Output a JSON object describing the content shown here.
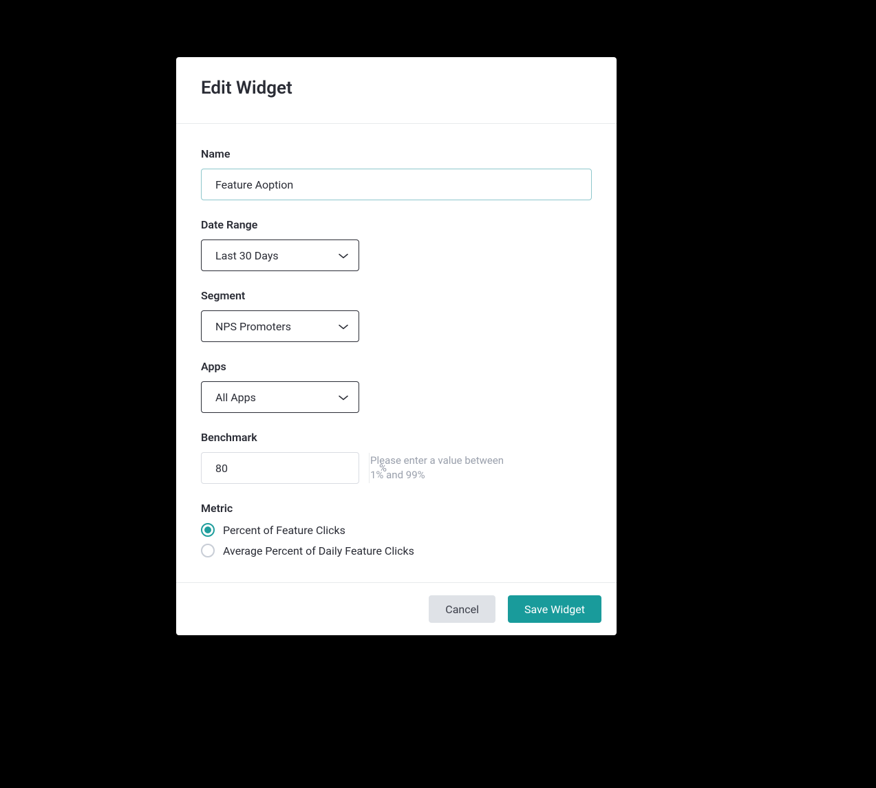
{
  "modal": {
    "title": "Edit Widget",
    "fields": {
      "name": {
        "label": "Name",
        "value": "Feature Aoption"
      },
      "date_range": {
        "label": "Date Range",
        "selected": "Last 30 Days"
      },
      "segment": {
        "label": "Segment",
        "selected": "NPS Promoters"
      },
      "apps": {
        "label": "Apps",
        "selected": "All Apps"
      },
      "benchmark": {
        "label": "Benchmark",
        "value": "80",
        "suffix": "%",
        "hint": "Please enter a value between 1% and 99%"
      },
      "metric": {
        "label": "Metric",
        "options": [
          {
            "label": "Percent of Feature Clicks",
            "selected": true
          },
          {
            "label": "Average Percent of Daily Feature Clicks",
            "selected": false
          }
        ]
      }
    },
    "footer": {
      "cancel": "Cancel",
      "save": "Save Widget"
    }
  }
}
